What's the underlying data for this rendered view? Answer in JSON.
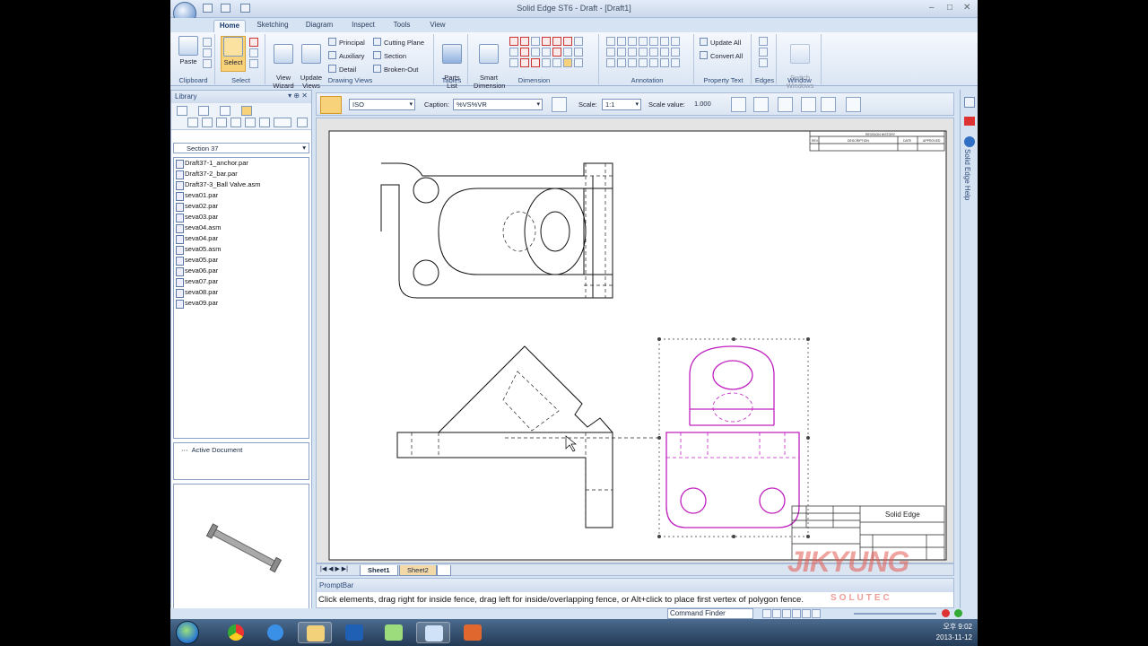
{
  "window": {
    "title": "Solid Edge ST6 - Draft - [Draft1]"
  },
  "tabs": [
    "Home",
    "Sketching",
    "Diagram",
    "Inspect",
    "Tools",
    "View"
  ],
  "ribbon": {
    "clipboard": {
      "label": "Clipboard",
      "paste": "Paste"
    },
    "select": {
      "label": "Select",
      "button": "Select"
    },
    "drawing_views": {
      "label": "Drawing Views",
      "view_wizard": "View\nWizard",
      "update_views": "Update\nViews",
      "principal": "Principal",
      "auxiliary": "Auxiliary",
      "detail": "Detail",
      "cutting_plane": "Cutting Plane",
      "section": "Section",
      "broken_out": "Broken-Out"
    },
    "tables": {
      "label": "Tables",
      "parts_list": "Parts\nList"
    },
    "dimension": {
      "label": "Dimension",
      "smart_dimension": "Smart\nDimension"
    },
    "annotation": {
      "label": "Annotation"
    },
    "property_text": {
      "label": "Property Text",
      "update_all": "Update All",
      "convert_all": "Convert All"
    },
    "edges": {
      "label": "Edges"
    },
    "window": {
      "label": "Window",
      "switch_windows": "Switch\nWindows"
    }
  },
  "library": {
    "title": "Library",
    "folder": "Section 37",
    "files": [
      "Draft37-1_anchor.par",
      "Draft37-2_bar.par",
      "Draft37-3_Ball Valve.asm",
      "seva01.par",
      "seva02.par",
      "seva03.par",
      "seva04.asm",
      "seva04.par",
      "seva05.asm",
      "seva05.par",
      "seva06.par",
      "seva07.par",
      "seva08.par",
      "seva09.par"
    ],
    "active_document": "Active Document"
  },
  "view_toolbar": {
    "standard": "ISO",
    "caption_label": "Caption:",
    "caption_value": "%VS%VR",
    "scale_label": "Scale:",
    "scale_value": "1:1",
    "scale_value_label": "Scale value:",
    "scale_value_number": "1.000"
  },
  "sheets": [
    "Sheet1",
    "Sheet2"
  ],
  "prompt": {
    "title": "PromptBar",
    "text": "Click elements, drag right for inside fence, drag left for inside/overlapping fence, or Alt+click to place first vertex of polygon fence."
  },
  "command_finder": "Command Finder",
  "help_tab": "Solid Edge Help",
  "titleblock": {
    "company": "Solid Edge",
    "revision_history": "REVISION HISTORY",
    "rev": "REV",
    "description": "DESCRIPTION",
    "date": "DATE",
    "approved": "APPROVED"
  },
  "watermark": {
    "brand": "JIKYUNG",
    "sub": "SOLUTEC"
  },
  "clock": {
    "time": "오후 9:02",
    "date": "2013-11-12"
  },
  "colors": {
    "selection": "#c020c0",
    "accent_orange": "#f5c74c"
  }
}
